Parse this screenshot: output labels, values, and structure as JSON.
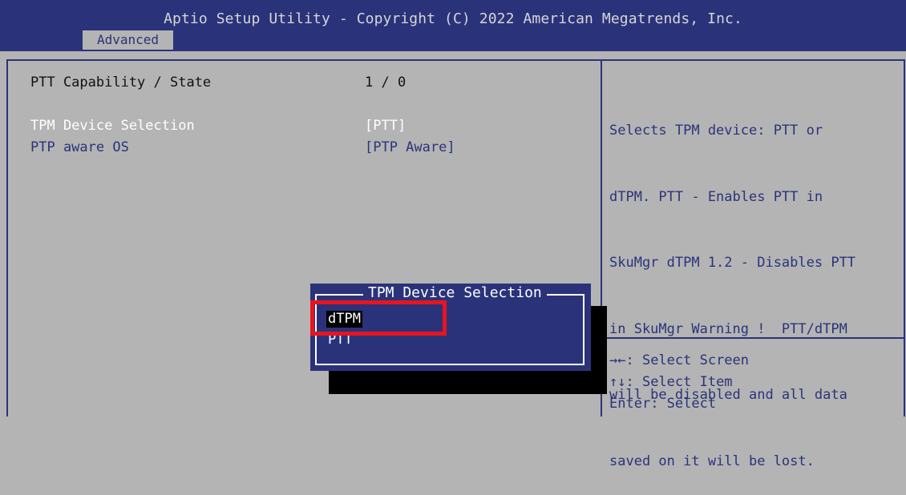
{
  "header": {
    "title": "Aptio Setup Utility - Copyright (C) 2022 American Megatrends, Inc.",
    "active_tab": "Advanced"
  },
  "settings": [
    {
      "label": "PTT Capability / State",
      "value": "1 / 0"
    },
    {
      "label": "TPM Device Selection",
      "value": "[PTT]"
    },
    {
      "label": "PTP aware OS",
      "value": "[PTP Aware]"
    }
  ],
  "help": {
    "lines": [
      "Selects TPM device: PTT or",
      "dTPM. PTT - Enables PTT in",
      "SkuMgr dTPM 1.2 - Disables PTT",
      "in SkuMgr Warning !  PTT/dTPM",
      "will be disabled and all data",
      "saved on it will be lost."
    ]
  },
  "keys": [
    {
      "key": "→←",
      "action": ": Select Screen"
    },
    {
      "key": "↑↓",
      "action": ": Select Item"
    },
    {
      "key": "Enter",
      "action": ": Select"
    }
  ],
  "popup": {
    "title": "TPM Device Selection",
    "options": [
      "dTPM",
      "PTT"
    ],
    "highlighted": "dTPM"
  },
  "colors": {
    "header_bg": "#2a337a",
    "panel_bg": "#b4b4b4",
    "highlight_box": "#e8141e"
  }
}
